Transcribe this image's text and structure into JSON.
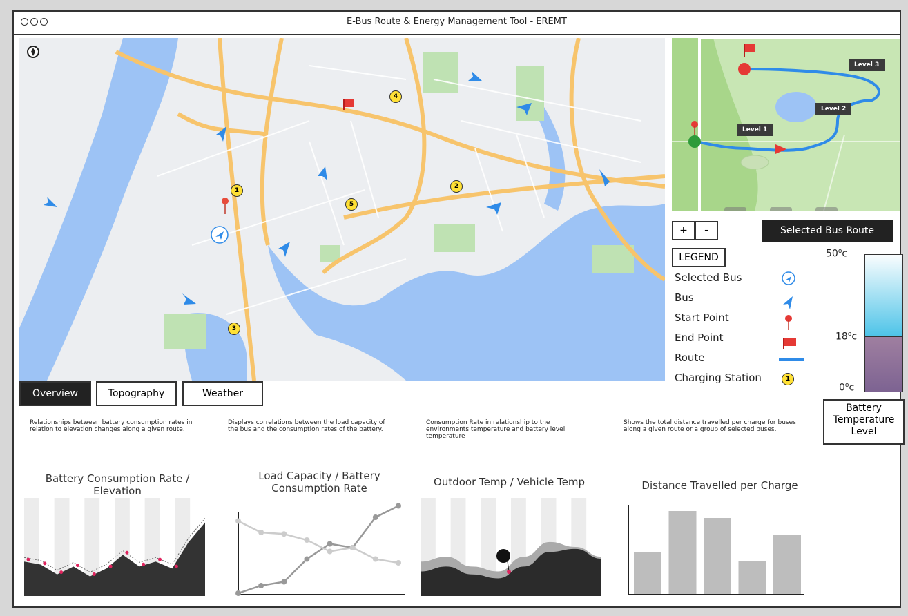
{
  "window": {
    "title": "E-Bus Route & Energy Management Tool  - EREMT"
  },
  "map": {
    "stations": [
      "1",
      "2",
      "3",
      "4",
      "5"
    ],
    "compass_icon": "compass-icon"
  },
  "mini_map": {
    "levels": [
      "Level 1",
      "Level 2",
      "Level 3"
    ],
    "buttons": [
      "eye-icon",
      "navigation-icon",
      "share-icon"
    ]
  },
  "zoom": {
    "in": "+",
    "out": "-"
  },
  "selected_route_button": "Selected Bus Route",
  "legend": {
    "title": "LEGEND",
    "items": [
      "Selected Bus",
      "Bus",
      "Start Point",
      "End Point",
      "Route",
      "Charging Station"
    ],
    "station_marker": "1"
  },
  "temperature": {
    "max": "50",
    "mid": "18",
    "min": "0",
    "unit_sup": "o",
    "unit": "c",
    "label": "Battery Temperature Level",
    "fill_fraction": 0.4
  },
  "tabs": [
    "Overview",
    "Topography",
    "Weather"
  ],
  "charts": [
    {
      "description": "Relationships between battery consumption rates in relation to elevation changes along a given route.",
      "title": "Battery Consumption Rate / Elevation"
    },
    {
      "description": "Displays correlations between the load capacity of the bus and the consumption rates of the battery.",
      "title": "Load Capacity / Battery Consumption Rate"
    },
    {
      "description": "Consumption Rate in relationship to the environments temperature and battery level temperature",
      "title": "Outdoor Temp / Vehicle Temp"
    },
    {
      "description": "Shows the total distance travelled per charge for buses along a given route or a group of selected buses.",
      "title": "Distance Travelled per Charge"
    }
  ],
  "chart_data": [
    {
      "type": "area",
      "title": "Battery Consumption Rate / Elevation",
      "series": [
        {
          "values": [
            35,
            32,
            22,
            30,
            20,
            28,
            42,
            30,
            35,
            28,
            55,
            75
          ]
        }
      ],
      "points": [
        33,
        29,
        20,
        27,
        18,
        26,
        40,
        28,
        33,
        26
      ]
    },
    {
      "type": "line",
      "title": "Load Capacity / Battery Consumption Rate",
      "series": [
        {
          "values": [
            0,
            10,
            15,
            45,
            65,
            60,
            100,
            115
          ]
        },
        {
          "values": [
            95,
            80,
            78,
            70,
            55,
            60,
            45,
            40
          ]
        }
      ]
    },
    {
      "type": "area",
      "title": "Outdoor Temp / Vehicle Temp",
      "series": [
        {
          "values": [
            35,
            40,
            30,
            25,
            40,
            55,
            50,
            40
          ]
        },
        {
          "values": [
            25,
            30,
            22,
            18,
            30,
            45,
            48,
            38
          ]
        }
      ]
    },
    {
      "type": "bar",
      "title": "Distance Travelled per Charge",
      "values": [
        60,
        120,
        110,
        48,
        85
      ]
    }
  ]
}
